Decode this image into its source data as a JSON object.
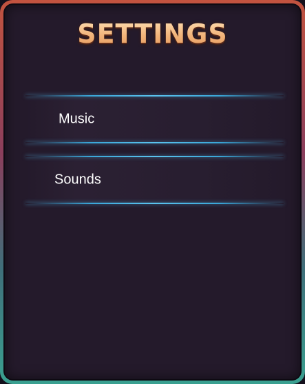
{
  "title": "SETTINGS",
  "settings": [
    {
      "label": "Music"
    },
    {
      "label": "Sounds"
    }
  ],
  "colors": {
    "frame_top": "#c2533f",
    "frame_bottom": "#3aa090",
    "panel_bg": "#241a2b",
    "title": "#f5c08a",
    "row_accent": "#3aa6d8"
  }
}
